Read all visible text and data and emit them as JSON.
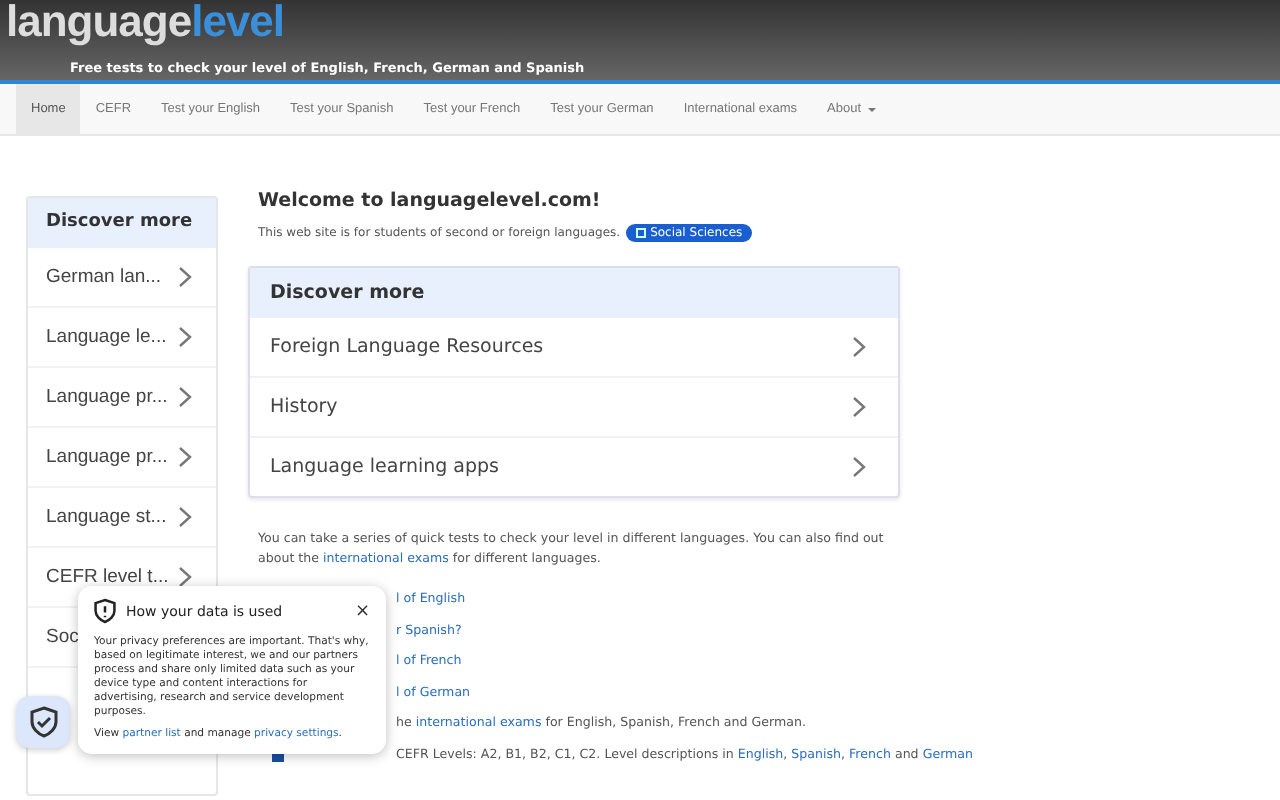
{
  "header": {
    "logo_part_1": "language",
    "logo_part_2": "level",
    "tagline": "Free tests to check your level of English, French, German and Spanish"
  },
  "nav": [
    {
      "label": "Home",
      "selected": true
    },
    {
      "label": "CEFR",
      "selected": false
    },
    {
      "label": "Test your English",
      "selected": false
    },
    {
      "label": "Test your Spanish",
      "selected": false
    },
    {
      "label": "Test your French",
      "selected": false
    },
    {
      "label": "Test your German",
      "selected": false
    },
    {
      "label": "International exams",
      "selected": false
    },
    {
      "label": "About",
      "selected": false,
      "dropdown": true
    }
  ],
  "sidebar": {
    "title": "Discover more",
    "items": [
      {
        "label": "German lan...",
        "chevron": true
      },
      {
        "label": "Language le...",
        "chevron": true
      },
      {
        "label": "Language pr...",
        "chevron": true
      },
      {
        "label": "Language pr...",
        "chevron": true
      },
      {
        "label": "Language st...",
        "chevron": true
      },
      {
        "label": "CEFR level t...",
        "chevron": true
      },
      {
        "label": "Soc",
        "chevron": false
      }
    ]
  },
  "main": {
    "title": "Welcome to languagelevel.com!",
    "intro": "This web site is for students of second or foreign languages.",
    "tag": "Social Sciences",
    "discover": {
      "title": "Discover more",
      "items": [
        "Foreign Language Resources",
        "History",
        "Language learning apps"
      ]
    },
    "paragraph": [
      {
        "kind": "text",
        "text": "You can take a series of quick tests to check your level in different languages. You can also find out about the "
      },
      {
        "kind": "link",
        "text": "international exams"
      },
      {
        "kind": "text",
        "text": " for different languages."
      }
    ],
    "list": [
      {
        "kind": "plain",
        "parts": [
          {
            "kind": "link",
            "text": "l of English"
          }
        ]
      },
      {
        "kind": "plain",
        "parts": [
          {
            "kind": "link",
            "text": "r Spanish?"
          }
        ]
      },
      {
        "kind": "plain",
        "parts": [
          {
            "kind": "link",
            "text": "l of French"
          }
        ]
      },
      {
        "kind": "plain",
        "parts": [
          {
            "kind": "link",
            "text": "l of German"
          }
        ]
      },
      {
        "kind": "plain",
        "parts": [
          {
            "kind": "text",
            "text": "he "
          },
          {
            "kind": "link",
            "text": "international exams"
          },
          {
            "kind": "text",
            "text": " for English, Spanish, French and German."
          }
        ]
      },
      {
        "kind": "square",
        "parts": [
          {
            "kind": "text",
            "text": "CEFR Levels: A2, B1, B2, C1, C2. Level descriptions in "
          },
          {
            "kind": "link",
            "text": "English"
          },
          {
            "kind": "text",
            "text": ", "
          },
          {
            "kind": "link",
            "text": "Spanish"
          },
          {
            "kind": "text",
            "text": ", "
          },
          {
            "kind": "link",
            "text": "French"
          },
          {
            "kind": "text",
            "text": " and "
          },
          {
            "kind": "link",
            "text": "German"
          }
        ]
      }
    ]
  },
  "privacy": {
    "title": "How your data is used",
    "close": "×",
    "body": "Your privacy preferences are important. That's why, based on legitimate interest, we and our partners process and share only limited data such as your device type and content interactions for advertising, research and service development purposes.",
    "footer": [
      {
        "kind": "text",
        "text": "View "
      },
      {
        "kind": "link",
        "text": "partner list"
      },
      {
        "kind": "text",
        "text": " and manage "
      },
      {
        "kind": "link",
        "text": "privacy settings"
      },
      {
        "kind": "text",
        "text": "."
      }
    ]
  }
}
